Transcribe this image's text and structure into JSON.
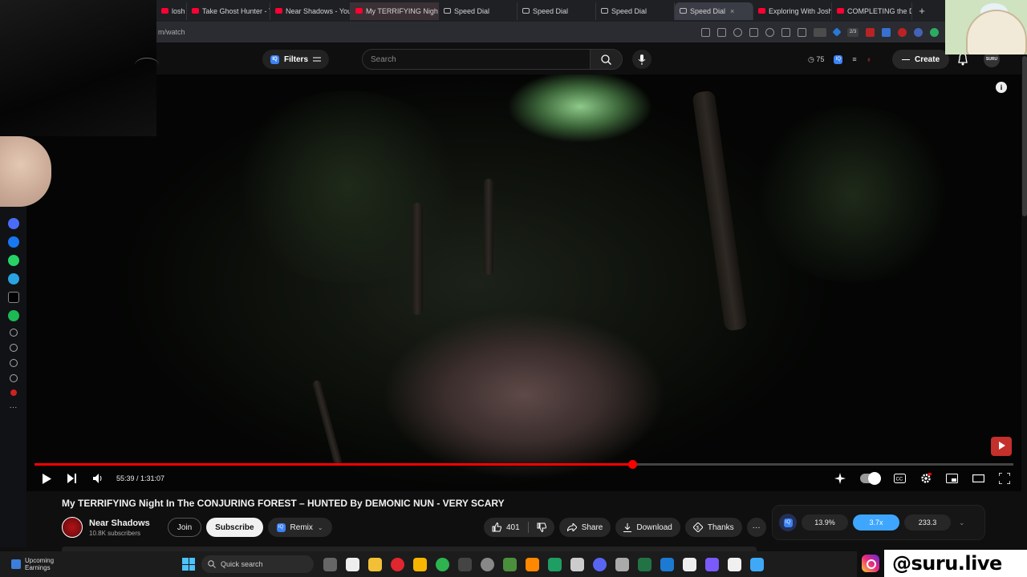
{
  "browser": {
    "tabs": [
      {
        "label": "losh -",
        "icon": "youtube"
      },
      {
        "label": "Take Ghost Hunter - Y",
        "icon": "youtube"
      },
      {
        "label": "Near Shadows - YouTu",
        "icon": "youtube"
      },
      {
        "label": "My TERRIFYING Night",
        "icon": "youtube",
        "active_style": true
      },
      {
        "label": "Speed Dial",
        "icon": "speed-dial"
      },
      {
        "label": "Speed Dial",
        "icon": "speed-dial"
      },
      {
        "label": "Speed Dial",
        "icon": "speed-dial"
      },
      {
        "label": "Speed Dial",
        "icon": "speed-dial",
        "active": true
      },
      {
        "label": "Exploring With Josh -",
        "icon": "youtube"
      },
      {
        "label": "COMPLETING the DEA",
        "icon": "youtube"
      }
    ],
    "new_tab": "+",
    "url": "m/watch",
    "ext_badge": "2/3"
  },
  "header": {
    "filters_label": "Filters",
    "search_placeholder": "Search",
    "counter": "75",
    "create_label": "Create",
    "user_avatar_text": "SURU"
  },
  "player": {
    "current_time": "55:39",
    "duration": "1:31:07",
    "time_display": "55:39 / 1:31:07",
    "progress_fraction": 0.611,
    "info_label": "i"
  },
  "video": {
    "title": "My TERRIFYING Night In The CONJURING FOREST – HUNTED By DEMONIC NUN - VERY SCARY",
    "channel_name": "Near Shadows",
    "subscribers": "10.8K subscribers",
    "join_label": "Join",
    "subscribe_label": "Subscribe",
    "remix_label": "Remix",
    "likes": "401",
    "share_label": "Share",
    "download_label": "Download",
    "thanks_label": "Thanks",
    "more_label": "···"
  },
  "stats": {
    "values": [
      "13.9%",
      "3.7x",
      "233.3"
    ]
  },
  "taskbar": {
    "weather_line1": "Upcoming",
    "weather_line2": "Earnings",
    "search_label": "Quick search"
  },
  "brand": {
    "handle": "@suru.live"
  },
  "colors": {
    "yt_red": "#ff0000",
    "accent_blue": "#3ea6ff",
    "background": "#0f0f0f"
  }
}
